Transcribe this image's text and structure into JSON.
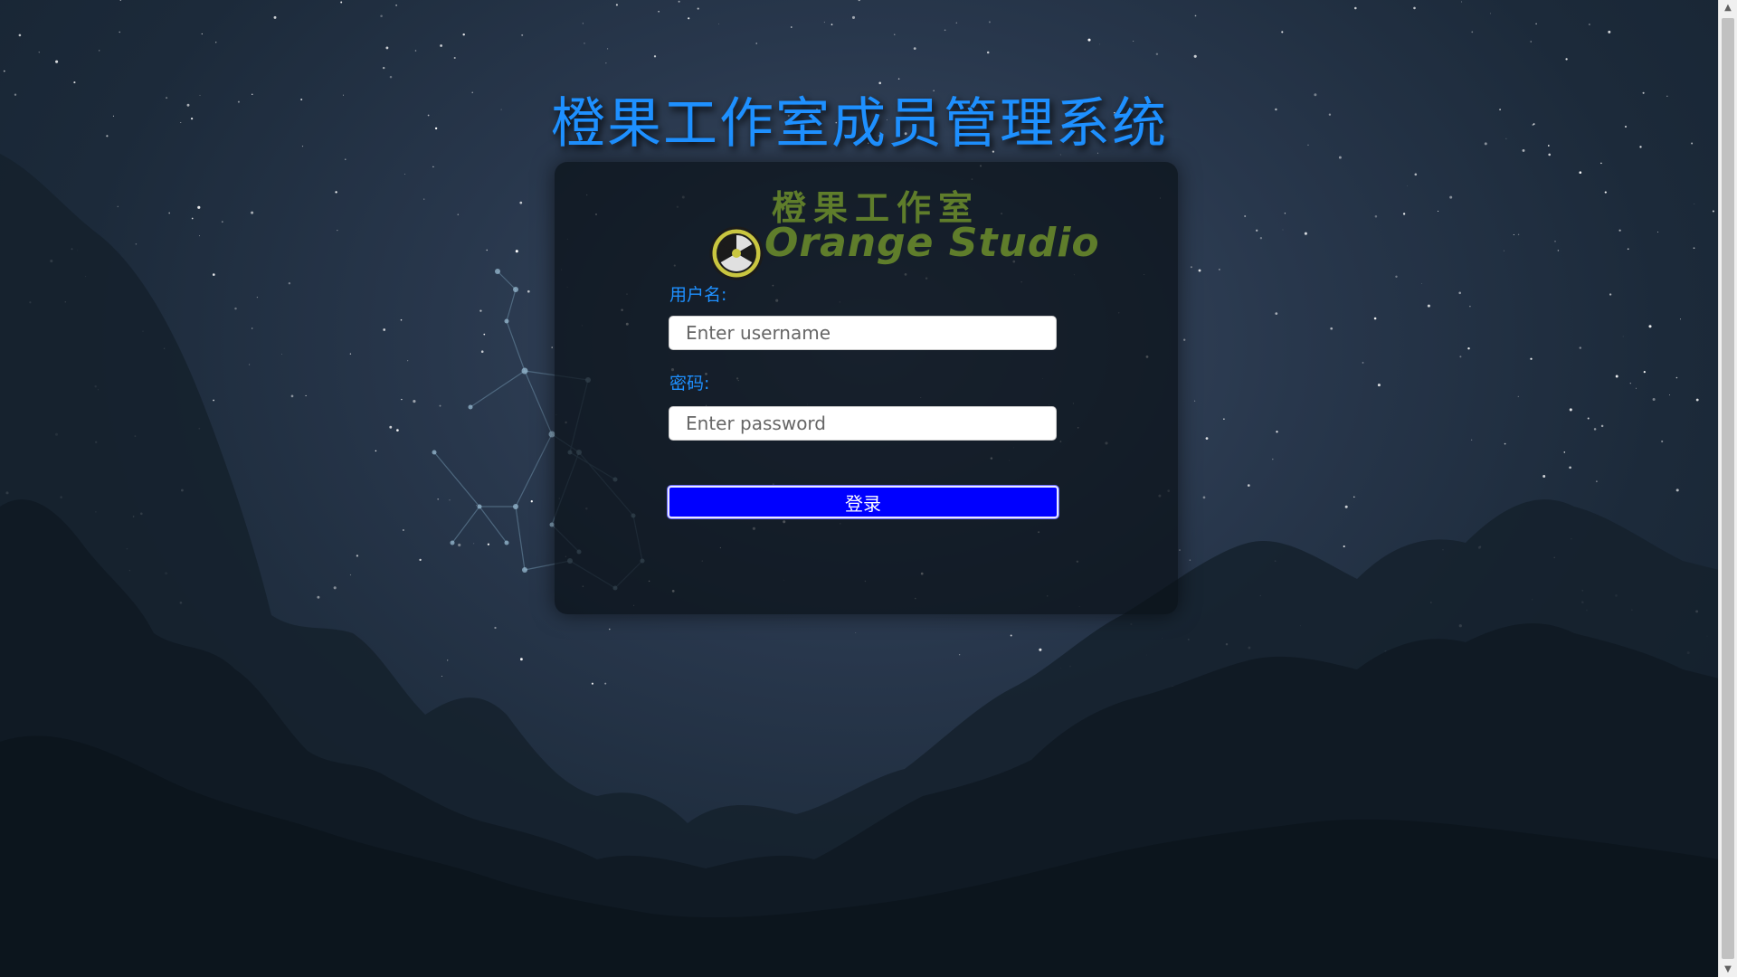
{
  "page": {
    "title": "橙果工作室成员管理系统"
  },
  "logo": {
    "chinese": "橙果工作室",
    "english": "Orange Studio",
    "color": "#5f7d2b"
  },
  "form": {
    "username_label": "用户名:",
    "username_placeholder": "Enter username",
    "username_value": "",
    "password_label": "密码:",
    "password_placeholder": "Enter password",
    "password_value": "",
    "login_label": "登录"
  },
  "colors": {
    "title": "#1e90ff",
    "label": "#1e90ff",
    "login_button": "#0000ff"
  }
}
